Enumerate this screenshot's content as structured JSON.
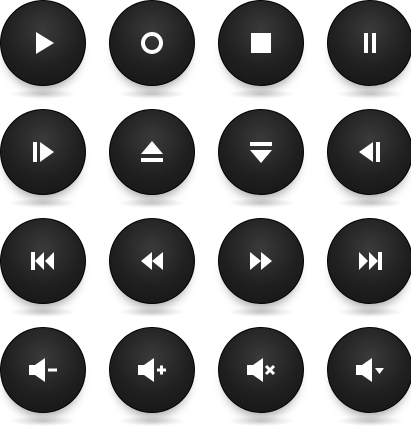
{
  "colors": {
    "button_fill": "#1f1f1f",
    "button_border": "#000000",
    "icon_fill": "#ffffff",
    "background": "#ffffff"
  },
  "buttons": [
    {
      "icon": "play-icon"
    },
    {
      "icon": "record-icon"
    },
    {
      "icon": "stop-icon"
    },
    {
      "icon": "pause-icon"
    },
    {
      "icon": "step-forward-icon"
    },
    {
      "icon": "eject-icon"
    },
    {
      "icon": "eject-down-icon"
    },
    {
      "icon": "step-back-icon"
    },
    {
      "icon": "skip-to-start-icon"
    },
    {
      "icon": "rewind-icon"
    },
    {
      "icon": "fast-forward-icon"
    },
    {
      "icon": "skip-to-end-icon"
    },
    {
      "icon": "volume-down-icon"
    },
    {
      "icon": "volume-up-icon"
    },
    {
      "icon": "volume-mute-icon"
    },
    {
      "icon": "volume-menu-icon"
    }
  ]
}
